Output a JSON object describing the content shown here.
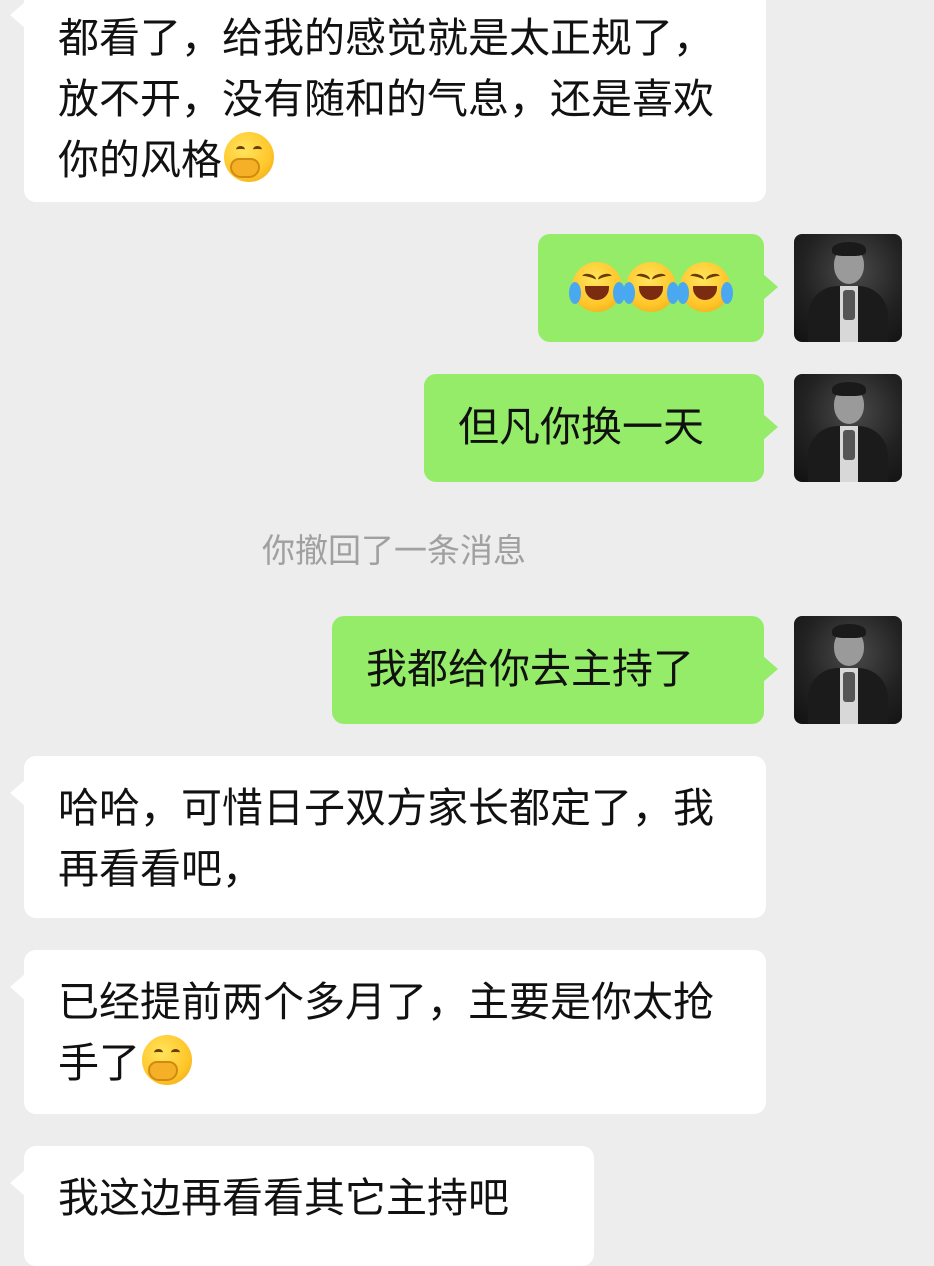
{
  "chat": {
    "messages": [
      {
        "id": "m1",
        "side": "in",
        "text": "都看了，给我的感觉就是太正规了，放不开，没有随和的气息，还是喜欢你的风格",
        "emoji": "face-with-hand-over-mouth-emoji"
      },
      {
        "id": "m2",
        "side": "out",
        "emoji": [
          "rolling-laughing-emoji",
          "rolling-laughing-emoji",
          "rolling-laughing-emoji"
        ]
      },
      {
        "id": "m3",
        "side": "out",
        "text": "但凡你换一天"
      },
      {
        "id": "m4",
        "side": "system",
        "text": "你撤回了一条消息"
      },
      {
        "id": "m5",
        "side": "out",
        "text": "我都给你去主持了"
      },
      {
        "id": "m6",
        "side": "in",
        "text": "哈哈，可惜日子双方家长都定了，我再看看吧，"
      },
      {
        "id": "m7",
        "side": "in",
        "text": "已经提前两个多月了，主要是你太抢手了",
        "emoji": "face-with-hand-over-mouth-emoji"
      },
      {
        "id": "m8",
        "side": "in",
        "text": "我这边再看看其它主持吧"
      }
    ]
  },
  "colors": {
    "background": "#ededed",
    "incoming_bubble": "#ffffff",
    "outgoing_bubble": "#95ec69",
    "system_text": "#a0a0a0"
  },
  "icons": {
    "avatar": "user-avatar-photo"
  }
}
